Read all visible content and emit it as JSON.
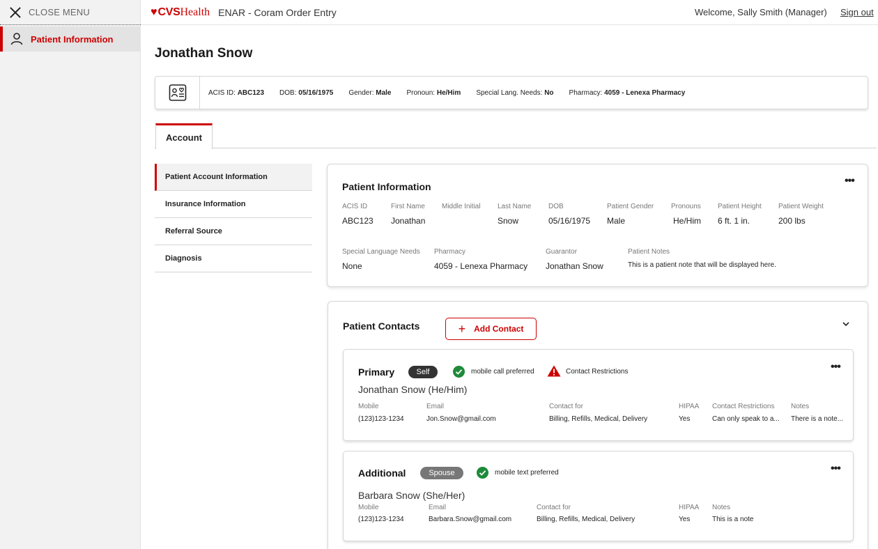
{
  "colors": {
    "brand": "#cc0000",
    "success": "#1e8a3a",
    "warning": "#cc0000"
  },
  "sidebar": {
    "close_label": "CLOSE MENU",
    "items": [
      {
        "label": "Patient Information",
        "icon": "person-icon",
        "active": true
      }
    ]
  },
  "header": {
    "brand_mark": "CVS",
    "brand_word": "Health",
    "app_title": "ENAR - Coram Order Entry",
    "welcome": "Welcome, Sally Smith (Manager)",
    "sign_out": "Sign out"
  },
  "page": {
    "title": "Jonathan Snow"
  },
  "summary": {
    "acis_label": "ACIS ID:",
    "acis_value": "ABC123",
    "dob_label": "DOB:",
    "dob_value": "05/16/1975",
    "gender_label": "Gender:",
    "gender_value": "Male",
    "pronoun_label": "Pronoun:",
    "pronoun_value": "He/Him",
    "lang_label": "Special Lang. Needs:",
    "lang_value": "No",
    "pharmacy_label": "Pharmacy:",
    "pharmacy_value": "4059 - Lenexa Pharmacy"
  },
  "tabs": [
    {
      "label": "Account",
      "active": true
    }
  ],
  "subnav": [
    {
      "label": "Patient Account Information",
      "active": true
    },
    {
      "label": "Insurance Information"
    },
    {
      "label": "Referral Source"
    },
    {
      "label": "Diagnosis"
    }
  ],
  "patient_info": {
    "title": "Patient Information",
    "more": "•••",
    "fields": {
      "acis": {
        "label": "ACIS ID",
        "value": "ABC123"
      },
      "first": {
        "label": "First Name",
        "value": "Jonathan"
      },
      "middle": {
        "label": "Middle Initial",
        "value": ""
      },
      "last": {
        "label": "Last Name",
        "value": "Snow"
      },
      "dob": {
        "label": "DOB",
        "value": "05/16/1975"
      },
      "gender": {
        "label": "Patient Gender",
        "value": "Male"
      },
      "pronouns": {
        "label": "Pronouns",
        "value": "He/Him"
      },
      "height": {
        "label": "Patient Height",
        "value": "6 ft. 1 in."
      },
      "weight": {
        "label": "Patient Weight",
        "value": "200 lbs"
      },
      "lang": {
        "label": "Special Language Needs",
        "value": "None"
      },
      "pharmacy": {
        "label": "Pharmacy",
        "value": "4059 - Lenexa Pharmacy"
      },
      "guarantor": {
        "label": "Guarantor",
        "value": "Jonathan Snow"
      },
      "notes": {
        "label": "Patient Notes",
        "value": "This is a patient note that will be displayed here."
      }
    }
  },
  "contacts": {
    "title": "Patient Contacts",
    "add_label": "Add Contact",
    "list": [
      {
        "type": "Primary",
        "relation": "Self",
        "preference": "mobile call preferred",
        "restriction_flag": "Contact Restrictions",
        "name": "Jonathan Snow (He/Him)",
        "more": "•••",
        "mobile_label": "Mobile",
        "mobile": "(123)123-1234",
        "email_label": "Email",
        "email": "Jon.Snow@gmail.com",
        "contact_for_label": "Contact for",
        "contact_for": "Billing, Refills, Medical, Delivery",
        "hipaa_label": "HIPAA",
        "hipaa": "Yes",
        "restrictions_label": "Contact Restrictions",
        "restrictions": "Can only speak to a...",
        "notes_label": "Notes",
        "notes": "There is a note..."
      },
      {
        "type": "Additional",
        "relation": "Spouse",
        "preference": "mobile text preferred",
        "name": "Barbara Snow (She/Her)",
        "more": "•••",
        "mobile_label": "Mobile",
        "mobile": "(123)123-1234",
        "email_label": "Email",
        "email": "Barbara.Snow@gmail.com",
        "contact_for_label": "Contact for",
        "contact_for": "Billing, Refills, Medical, Delivery",
        "hipaa_label": "HIPAA",
        "hipaa": "Yes",
        "notes_label": "Notes",
        "notes": "This is a note"
      }
    ]
  }
}
